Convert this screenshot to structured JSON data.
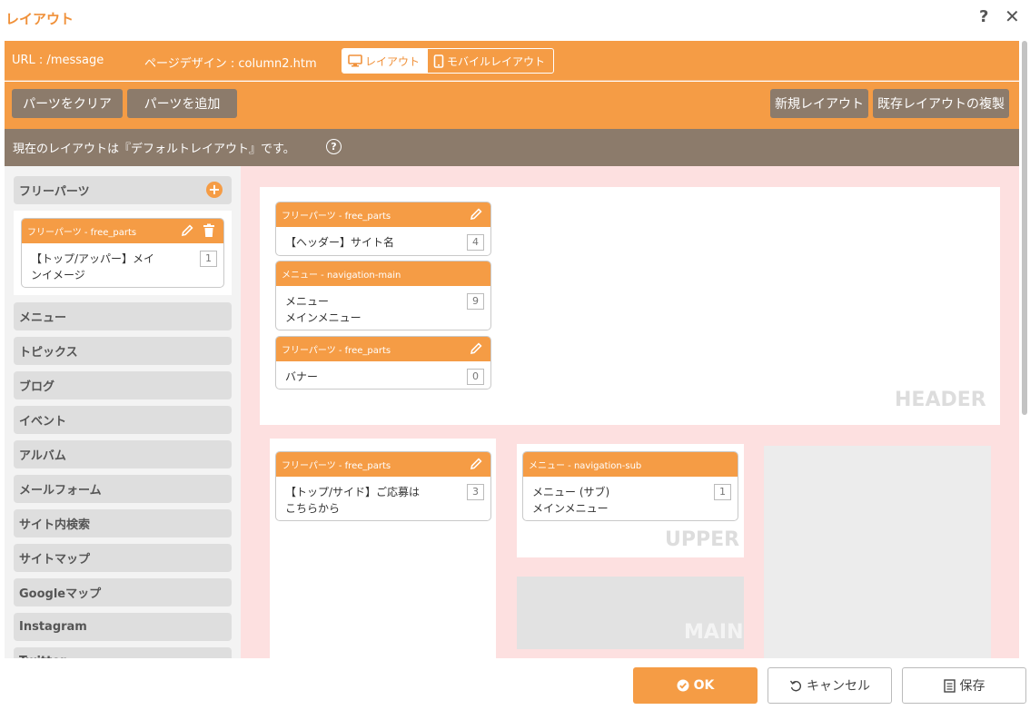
{
  "dialog": {
    "title": "レイアウト",
    "help": "?",
    "close": "✕"
  },
  "topbar": {
    "url": "URL : /message",
    "design": "ページデザイン : column2.htm",
    "layout_tab": "レイアウト",
    "mobile_tab": "モバイルレイアウト"
  },
  "toolbar": {
    "clear_parts": "パーツをクリア",
    "add_parts": "パーツを追加",
    "new_layout": "新規レイアウト",
    "copy_layout": "既存レイアウトの複製"
  },
  "status": {
    "text": "現在のレイアウトは『デフォルトレイアウト』です。",
    "help": "?"
  },
  "sidebar": {
    "expanded": {
      "label": "フリーパーツ",
      "card": {
        "title": "フリーパーツ - free_parts",
        "line1": "【トップ/アッパー】メイ",
        "line2": "ンイメージ",
        "count": "1"
      }
    },
    "categories": [
      "メニュー",
      "トピックス",
      "ブログ",
      "イベント",
      "アルバム",
      "メールフォーム",
      "サイト内検索",
      "サイトマップ",
      "Googleマップ",
      "Instagram",
      "Twitter"
    ]
  },
  "regions": {
    "header": {
      "label": "HEADER",
      "cards": [
        {
          "title": "フリーパーツ - free_parts",
          "line1": "【ヘッダー】サイト名",
          "line2": "",
          "count": "4"
        },
        {
          "title": "メニュー - navigation-main",
          "line1": "メニュー",
          "line2": "メインメニュー",
          "count": "9"
        },
        {
          "title": "フリーパーツ - free_parts",
          "line1": "バナー",
          "line2": "",
          "count": "0"
        }
      ]
    },
    "left": {
      "cards": [
        {
          "title": "フリーパーツ - free_parts",
          "line1": "【トップ/サイド】ご応募は",
          "line2": "こちらから",
          "count": "3"
        }
      ]
    },
    "upper": {
      "label": "UPPER",
      "cards": [
        {
          "title": "メニュー - navigation-sub",
          "line1": "メニュー (サブ)",
          "line2": "メインメニュー",
          "count": "1"
        }
      ]
    },
    "main": {
      "label": "MAIN"
    }
  },
  "footer": {
    "ok": "OK",
    "cancel": "キャンセル",
    "save": "保存"
  },
  "colors": {
    "accent": "#f59c45",
    "brown": "#8c7b6b",
    "canvas_pink": "#fde0e0"
  }
}
